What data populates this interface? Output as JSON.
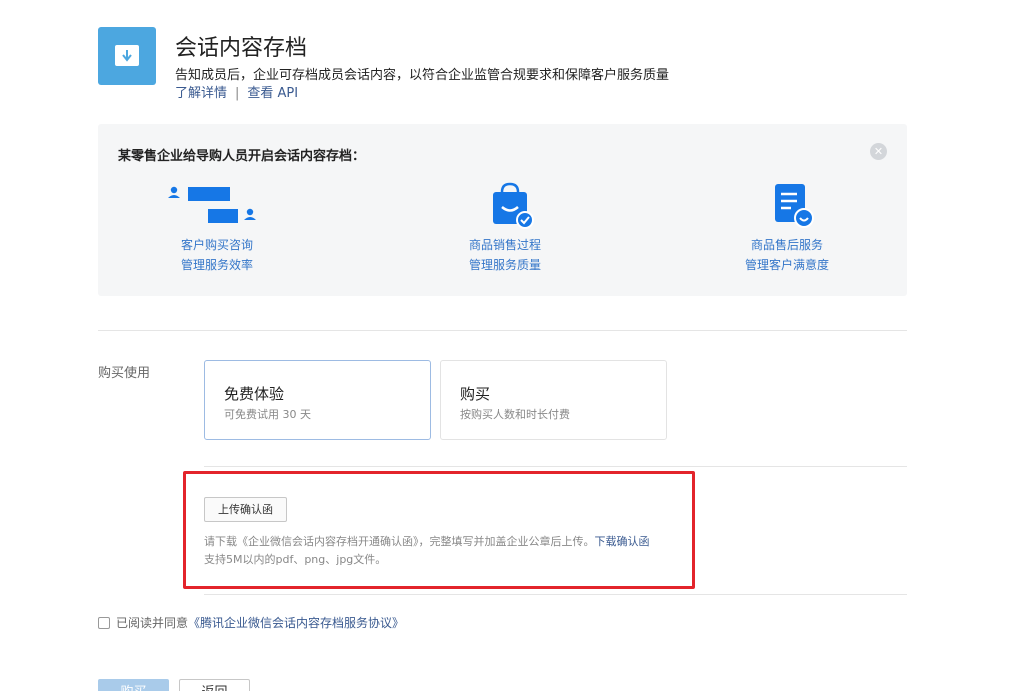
{
  "header": {
    "title": "会话内容存档",
    "description": "告知成员后，企业可存档成员会话内容，以符合企业监管合规要求和保障客户服务质量",
    "learn_more": "了解详情",
    "separator": "|",
    "view_api": "查看 API",
    "icon": "download-box-icon"
  },
  "panel": {
    "title": "某零售企业给导购人员开启会话内容存档：",
    "close_icon": "close-icon",
    "features": [
      {
        "icon": "chat-bubbles-icon",
        "line1": "客户购买咨询",
        "line2": "管理服务效率"
      },
      {
        "icon": "shopping-bag-check-icon",
        "line1": "商品销售过程",
        "line2": "管理服务质量"
      },
      {
        "icon": "document-smile-icon",
        "line1": "商品售后服务",
        "line2": "管理客户满意度"
      }
    ]
  },
  "purchase": {
    "label": "购买使用",
    "options": [
      {
        "name": "免费体验",
        "sub": "可免费试用 30 天",
        "selected": true
      },
      {
        "name": "购买",
        "sub": "按购买人数和时长付费",
        "selected": false
      }
    ]
  },
  "upload": {
    "button": "上传确认函",
    "hint_prefix": "请下载《企业微信会话内容存档开通确认函》，完整填写并加盖企业公章后上传。",
    "hint_link": "下载确认函",
    "hint_formats": "支持5M以内的pdf、png、jpg文件。"
  },
  "agreement": {
    "text": "已阅读并同意",
    "link": "《腾讯企业微信会话内容存档服务协议》"
  },
  "actions": {
    "primary": "购买",
    "secondary": "返回"
  },
  "colors": {
    "accent": "#4ca7e0",
    "link": "#3a5a90",
    "feature_text": "#3476c9",
    "highlight_border": "#e3242b"
  }
}
